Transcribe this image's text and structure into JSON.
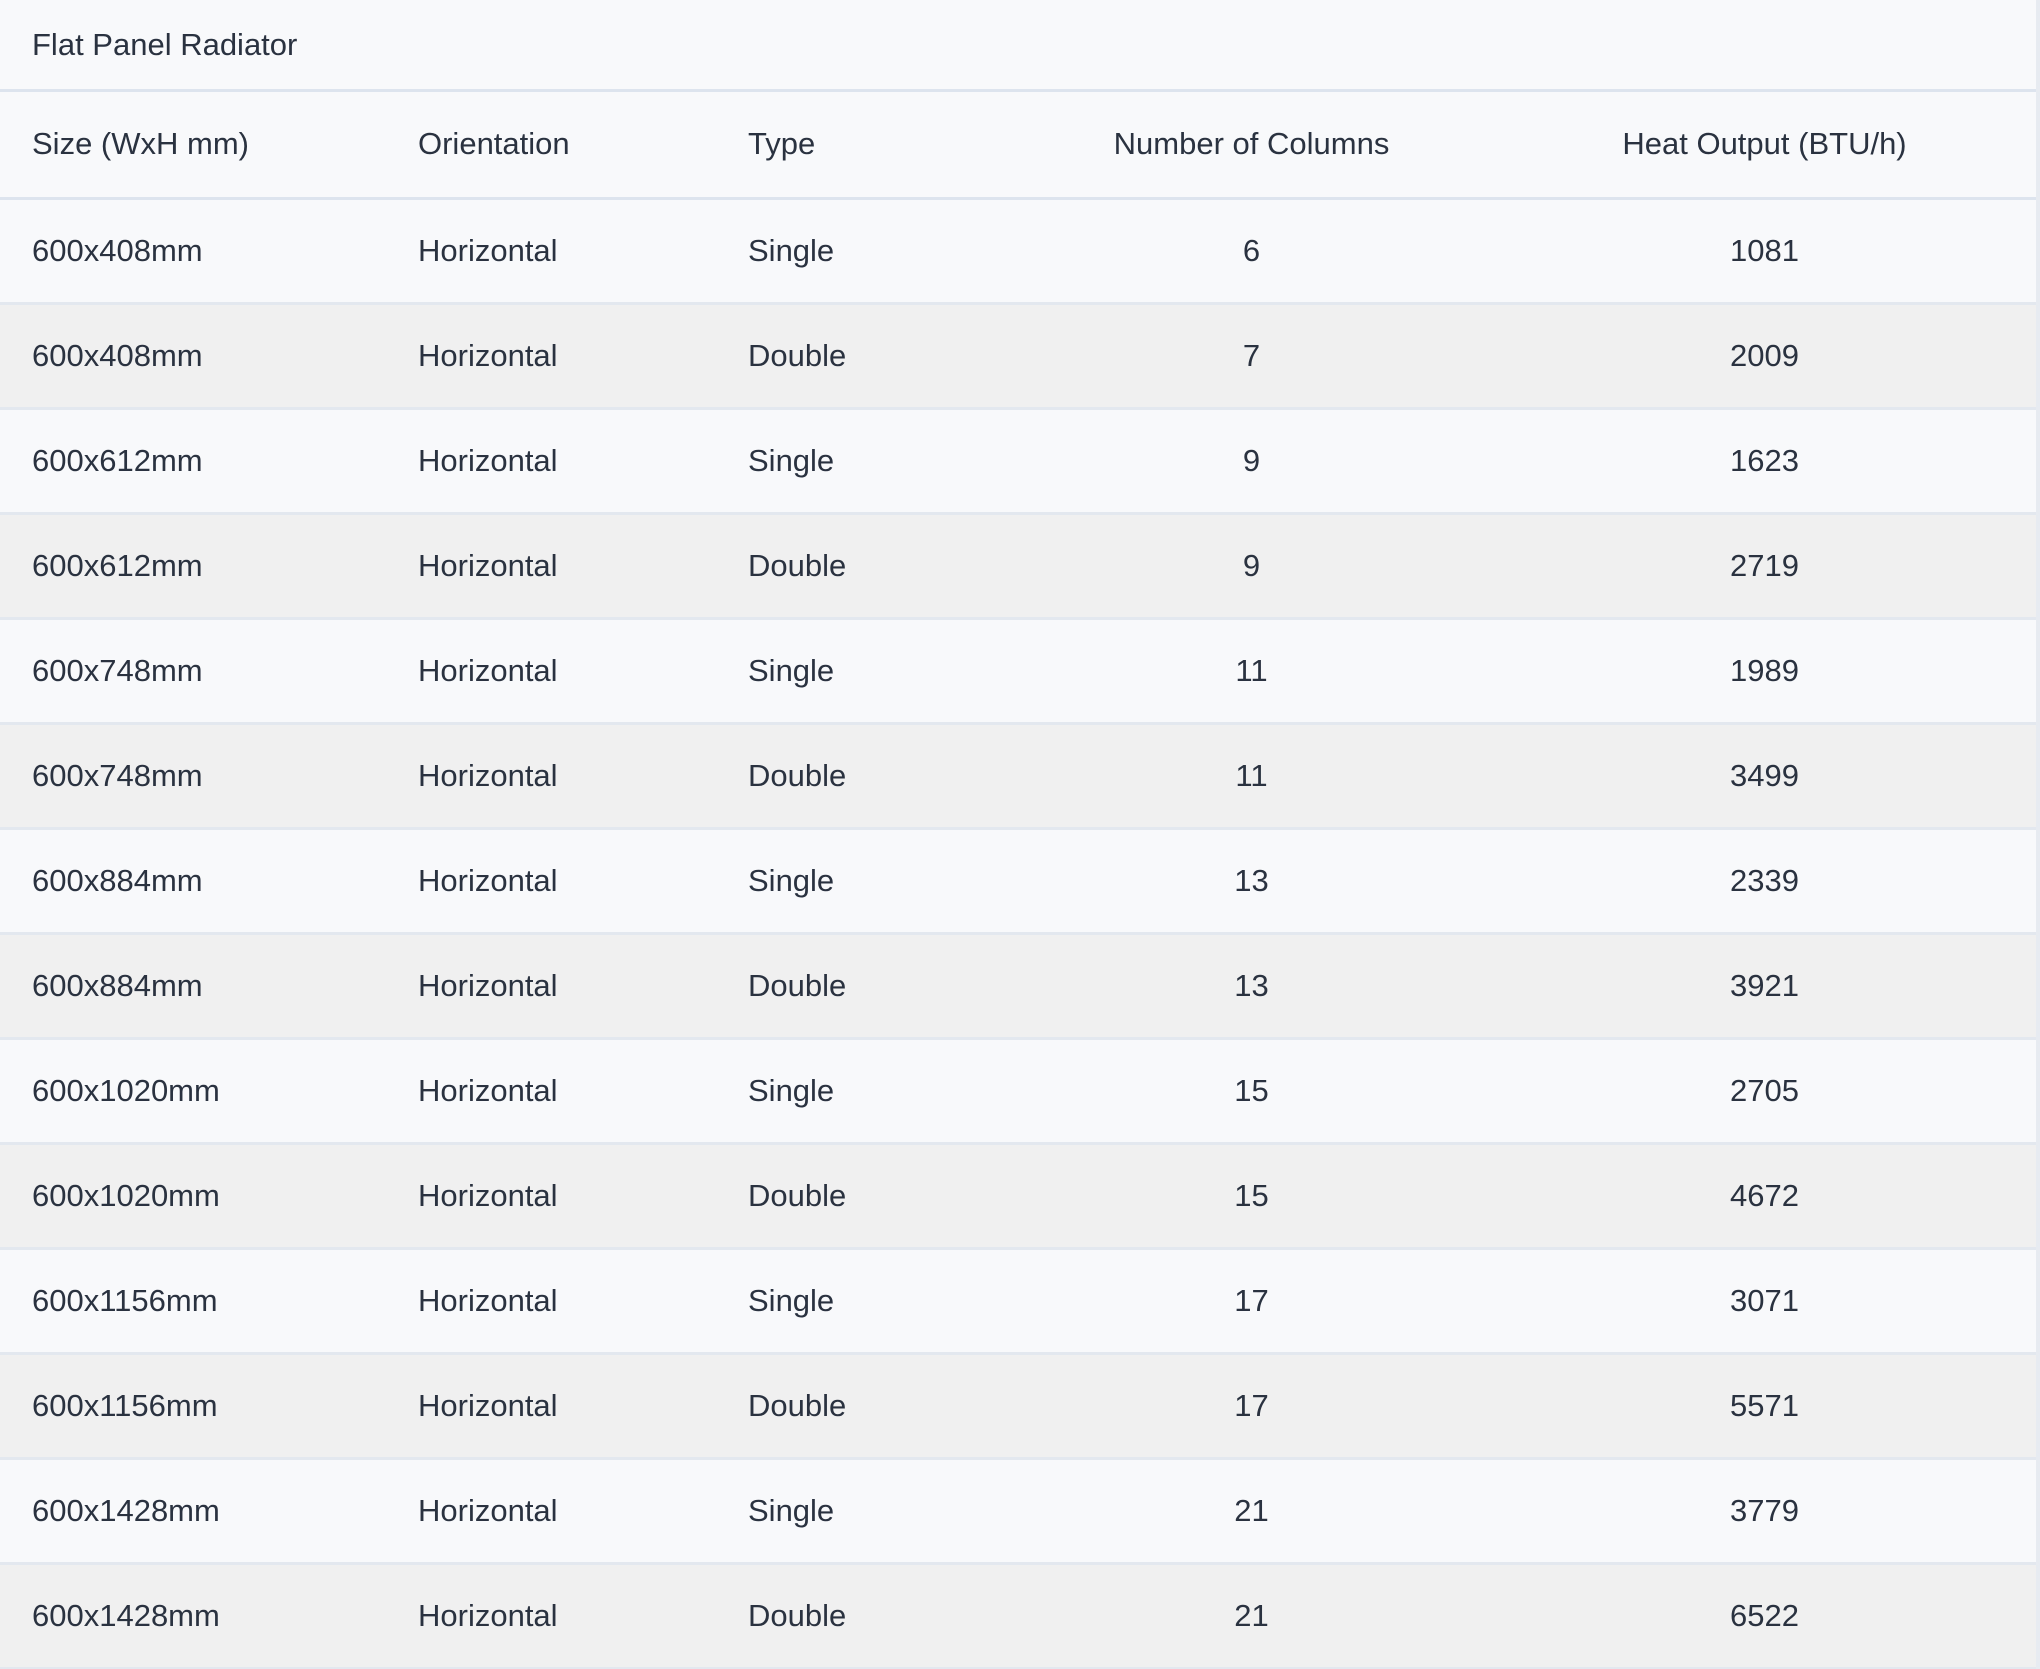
{
  "table": {
    "title": "Flat Panel Radiator",
    "columns": [
      "Size (WxH mm)",
      "Orientation",
      "Type",
      "Number of Columns",
      "Heat Output (BTU/h)"
    ],
    "rows": [
      [
        "600x408mm",
        "Horizontal",
        "Single",
        "6",
        "1081"
      ],
      [
        "600x408mm",
        "Horizontal",
        "Double",
        "7",
        "2009"
      ],
      [
        "600x612mm",
        "Horizontal",
        "Single",
        "9",
        "1623"
      ],
      [
        "600x612mm",
        "Horizontal",
        "Double",
        "9",
        "2719"
      ],
      [
        "600x748mm",
        "Horizontal",
        "Single",
        "11",
        "1989"
      ],
      [
        "600x748mm",
        "Horizontal",
        "Double",
        "11",
        "3499"
      ],
      [
        "600x884mm",
        "Horizontal",
        "Single",
        "13",
        "2339"
      ],
      [
        "600x884mm",
        "Horizontal",
        "Double",
        "13",
        "3921"
      ],
      [
        "600x1020mm",
        "Horizontal",
        "Single",
        "15",
        "2705"
      ],
      [
        "600x1020mm",
        "Horizontal",
        "Double",
        "15",
        "4672"
      ],
      [
        "600x1156mm",
        "Horizontal",
        "Single",
        "17",
        "3071"
      ],
      [
        "600x1156mm",
        "Horizontal",
        "Double",
        "17",
        "5571"
      ],
      [
        "600x1428mm",
        "Horizontal",
        "Single",
        "21",
        "3779"
      ],
      [
        "600x1428mm",
        "Horizontal",
        "Double",
        "21",
        "6522"
      ]
    ]
  },
  "colors": {
    "text": "#2a3240",
    "row_light": "#f8f9fb",
    "row_striped": "#f0f0f0",
    "divider": "#dde4ee"
  }
}
